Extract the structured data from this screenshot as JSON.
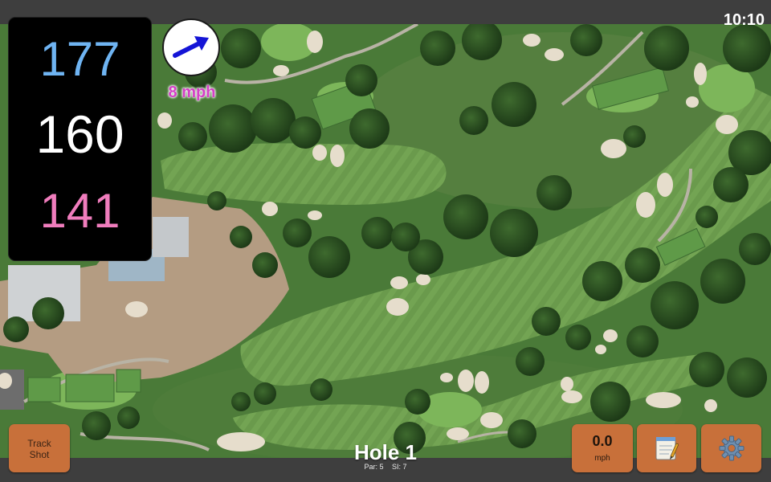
{
  "status": {
    "time": "10:10"
  },
  "distances": {
    "front": "177",
    "center": "160",
    "back": "141"
  },
  "wind": {
    "speed_label": "8 mph",
    "icon": "wind-direction-arrow-icon"
  },
  "hole": {
    "title": "Hole 1",
    "par_label": "Par: 5",
    "si_label": "SI: 7"
  },
  "buttons": {
    "track_shot_line1": "Track",
    "track_shot_line2": "Shot",
    "speed_value": "0.0",
    "speed_unit": "mph",
    "scorecard_icon": "notepad-icon",
    "settings_icon": "gear-icon"
  },
  "colors": {
    "front": "#6fb4f2",
    "center": "#ffffff",
    "back": "#f07dbd",
    "button": "#c8703a",
    "wind_text": "#d53fc6",
    "arrow": "#1414d6"
  }
}
